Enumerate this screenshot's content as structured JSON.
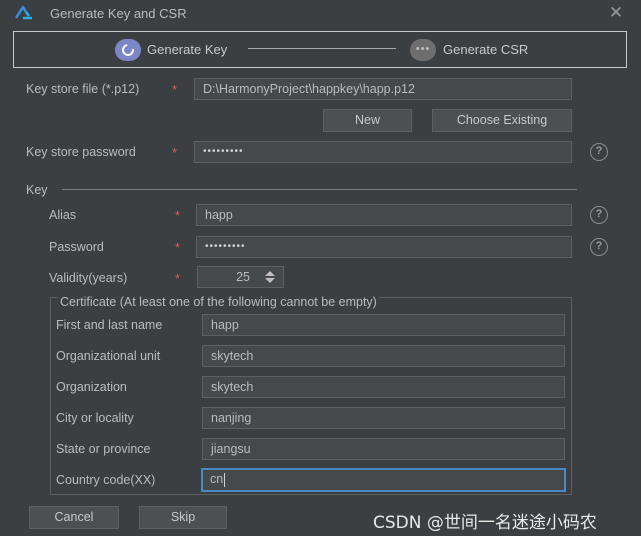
{
  "window": {
    "title": "Generate Key and CSR"
  },
  "steps": [
    {
      "label": "Generate Key",
      "active": true
    },
    {
      "label": "Generate CSR",
      "active": false
    }
  ],
  "keystore": {
    "file_label": "Key store file (*.p12)",
    "file_value": "D:\\HarmonyProject\\happkey\\happ.p12",
    "new_label": "New",
    "choose_label": "Choose Existing",
    "password_label": "Key store password",
    "password_value": "•••••••••"
  },
  "key": {
    "section_label": "Key",
    "alias_label": "Alias",
    "alias_value": "happ",
    "password_label": "Password",
    "password_value": "•••••••••",
    "validity_label": "Validity(years)",
    "validity_value": "25"
  },
  "certificate": {
    "title": "Certificate (At least one of the following cannot be empty)",
    "fields": [
      {
        "label": "First and last name",
        "value": "happ"
      },
      {
        "label": "Organizational unit",
        "value": "skytech"
      },
      {
        "label": "Organization",
        "value": "skytech"
      },
      {
        "label": "City or locality",
        "value": "nanjing"
      },
      {
        "label": "State or province",
        "value": "jiangsu"
      },
      {
        "label": "Country code(XX)",
        "value": "cn"
      }
    ]
  },
  "footer": {
    "cancel_label": "Cancel",
    "skip_label": "Skip"
  },
  "watermark": "CSDN @世间一名迷途小码农",
  "required_marker": "*",
  "help_glyph": "?",
  "close_glyph": "✕",
  "colors": {
    "background": "#3c3f41",
    "field_bg": "#45494a",
    "required": "#e05a5a",
    "focus": "#4a88c7",
    "step_active": "#7b87c9"
  }
}
